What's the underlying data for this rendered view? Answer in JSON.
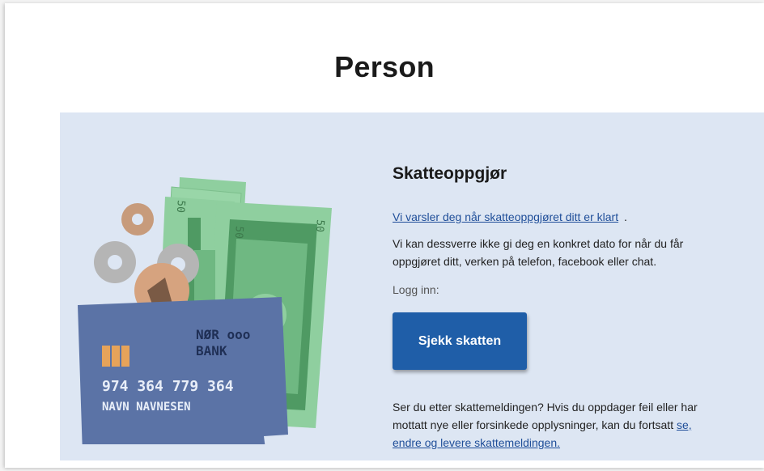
{
  "page": {
    "title": "Person"
  },
  "card": {
    "title": "Skatteoppgjør",
    "notify_link": "Vi varsler deg når skatteoppgjøret ditt er klart",
    "notify_suffix": ".",
    "description": "Vi kan dessverre ikke gi deg en konkret dato for når du får oppgjøret ditt, verken på telefon, facebook eller chat.",
    "login_label": "Logg inn:",
    "cta_label": "Sjekk skatten",
    "footer_text": "Ser du etter skattemeldingen? Hvis du oppdager feil eller har mottatt nye eller forsinkede opplysninger, kan du fortsatt ",
    "footer_link": "se, endre og levere skattemeldingen."
  },
  "illustration": {
    "bank_name_line1": "NØR ooo",
    "bank_name_line2": "BANK",
    "card_number": "974 364 779 364",
    "card_holder": "NAVN NAVNESEN",
    "banknote_value": "50"
  },
  "colors": {
    "panel_bg": "#dde6f3",
    "button_bg": "#1f5ea8",
    "link": "#1f4e99",
    "card_blue": "#5b73a6",
    "note_green": "#8fcf9f",
    "note_dark": "#4f9a63"
  }
}
